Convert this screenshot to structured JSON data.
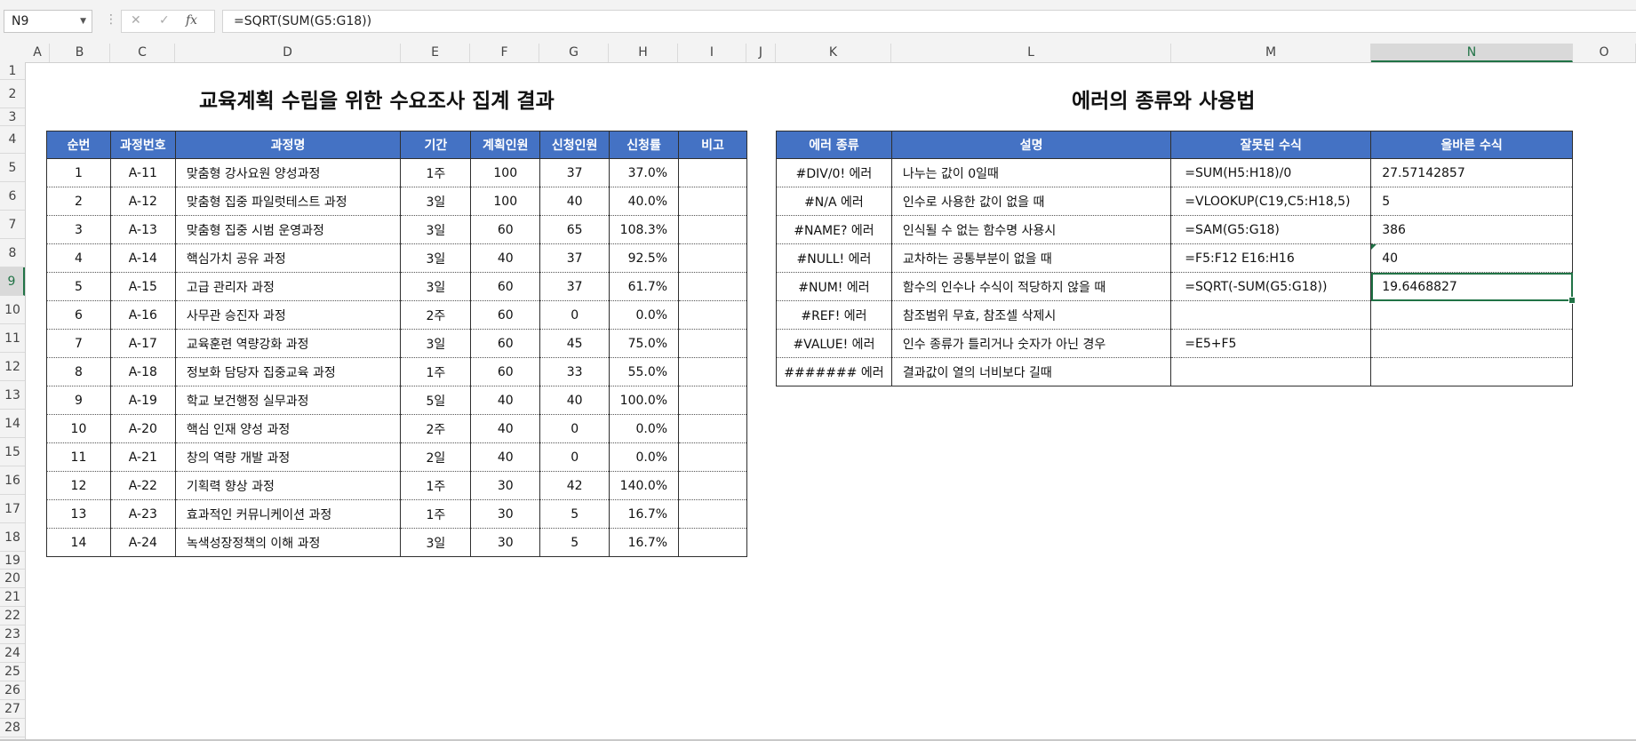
{
  "formula_bar": {
    "name_box": "N9",
    "formula": "=SQRT(SUM(G5:G18))",
    "cancel_icon": "x-icon",
    "enter_icon": "check-icon",
    "fx_label": "fx"
  },
  "columns": [
    "A",
    "B",
    "C",
    "D",
    "E",
    "F",
    "G",
    "H",
    "I",
    "J",
    "K",
    "L",
    "M",
    "N",
    "O"
  ],
  "selected_column": "N",
  "rows": [
    "1",
    "2",
    "3",
    "4",
    "5",
    "6",
    "7",
    "8",
    "9",
    "10",
    "11",
    "12",
    "13",
    "14",
    "15",
    "16",
    "17",
    "18",
    "19",
    "20",
    "21",
    "22",
    "23",
    "24",
    "25",
    "26",
    "27",
    "28"
  ],
  "selected_row": "9",
  "left_table": {
    "title": "교육계획 수립을 위한 수요조사 집계 결과",
    "headers": [
      "순번",
      "과정번호",
      "과정명",
      "기간",
      "계획인원",
      "신청인원",
      "신청률",
      "비고"
    ],
    "rows": [
      [
        "1",
        "A-11",
        "맞춤형 강사요원 양성과정",
        "1주",
        "100",
        "37",
        "37.0%",
        ""
      ],
      [
        "2",
        "A-12",
        "맞춤형 집중 파일럿테스트 과정",
        "3일",
        "100",
        "40",
        "40.0%",
        ""
      ],
      [
        "3",
        "A-13",
        "맞춤형 집중 시범 운영과정",
        "3일",
        "60",
        "65",
        "108.3%",
        ""
      ],
      [
        "4",
        "A-14",
        "핵심가치 공유 과정",
        "3일",
        "40",
        "37",
        "92.5%",
        ""
      ],
      [
        "5",
        "A-15",
        "고급 관리자 과정",
        "3일",
        "60",
        "37",
        "61.7%",
        ""
      ],
      [
        "6",
        "A-16",
        "사무관 승진자 과정",
        "2주",
        "60",
        "0",
        "0.0%",
        ""
      ],
      [
        "7",
        "A-17",
        "교육훈련 역량강화 과정",
        "3일",
        "60",
        "45",
        "75.0%",
        ""
      ],
      [
        "8",
        "A-18",
        "정보화 담당자 집중교육 과정",
        "1주",
        "60",
        "33",
        "55.0%",
        ""
      ],
      [
        "9",
        "A-19",
        "학교 보건행정 실무과정",
        "5일",
        "40",
        "40",
        "100.0%",
        ""
      ],
      [
        "10",
        "A-20",
        "핵심 인재 양성 과정",
        "2주",
        "40",
        "0",
        "0.0%",
        ""
      ],
      [
        "11",
        "A-21",
        "창의 역량 개발 과정",
        "2일",
        "40",
        "0",
        "0.0%",
        ""
      ],
      [
        "12",
        "A-22",
        "기획력 향상 과정",
        "1주",
        "30",
        "42",
        "140.0%",
        ""
      ],
      [
        "13",
        "A-23",
        "효과적인 커뮤니케이션 과정",
        "1주",
        "30",
        "5",
        "16.7%",
        ""
      ],
      [
        "14",
        "A-24",
        "녹색성장정책의 이해 과정",
        "3일",
        "30",
        "5",
        "16.7%",
        ""
      ]
    ]
  },
  "right_table": {
    "title": "에러의 종류와 사용법",
    "headers": [
      "에러 종류",
      "설명",
      "잘못된 수식",
      "올바른 수식"
    ],
    "rows": [
      [
        "#DIV/0! 에러",
        "나누는 값이 0일때",
        "=SUM(H5:H18)/0",
        "27.57142857"
      ],
      [
        "#N/A 에러",
        "인수로 사용한 값이 없을 때",
        "=VLOOKUP(C19,C5:H18,5)",
        "5"
      ],
      [
        "#NAME? 에러",
        "인식될 수 없는 함수명 사용시",
        "=SAM(G5:G18)",
        "386"
      ],
      [
        "#NULL! 에러",
        "교차하는 공통부분이 없을 때",
        "=F5:F12 E16:H16",
        "40"
      ],
      [
        "#NUM! 에러",
        "함수의 인수나 수식이 적당하지 않을 때",
        "=SQRT(-SUM(G5:G18))",
        "19.6468827"
      ],
      [
        "#REF! 에러",
        "참조범위 무효, 참조셀 삭제시",
        "",
        ""
      ],
      [
        "#VALUE! 에러",
        "인수 종류가 틀리거나 숫자가 아닌 경우",
        "=E5+F5",
        ""
      ],
      [
        "####### 에러",
        "결과값이 열의 너비보다 길때",
        "",
        ""
      ]
    ]
  }
}
